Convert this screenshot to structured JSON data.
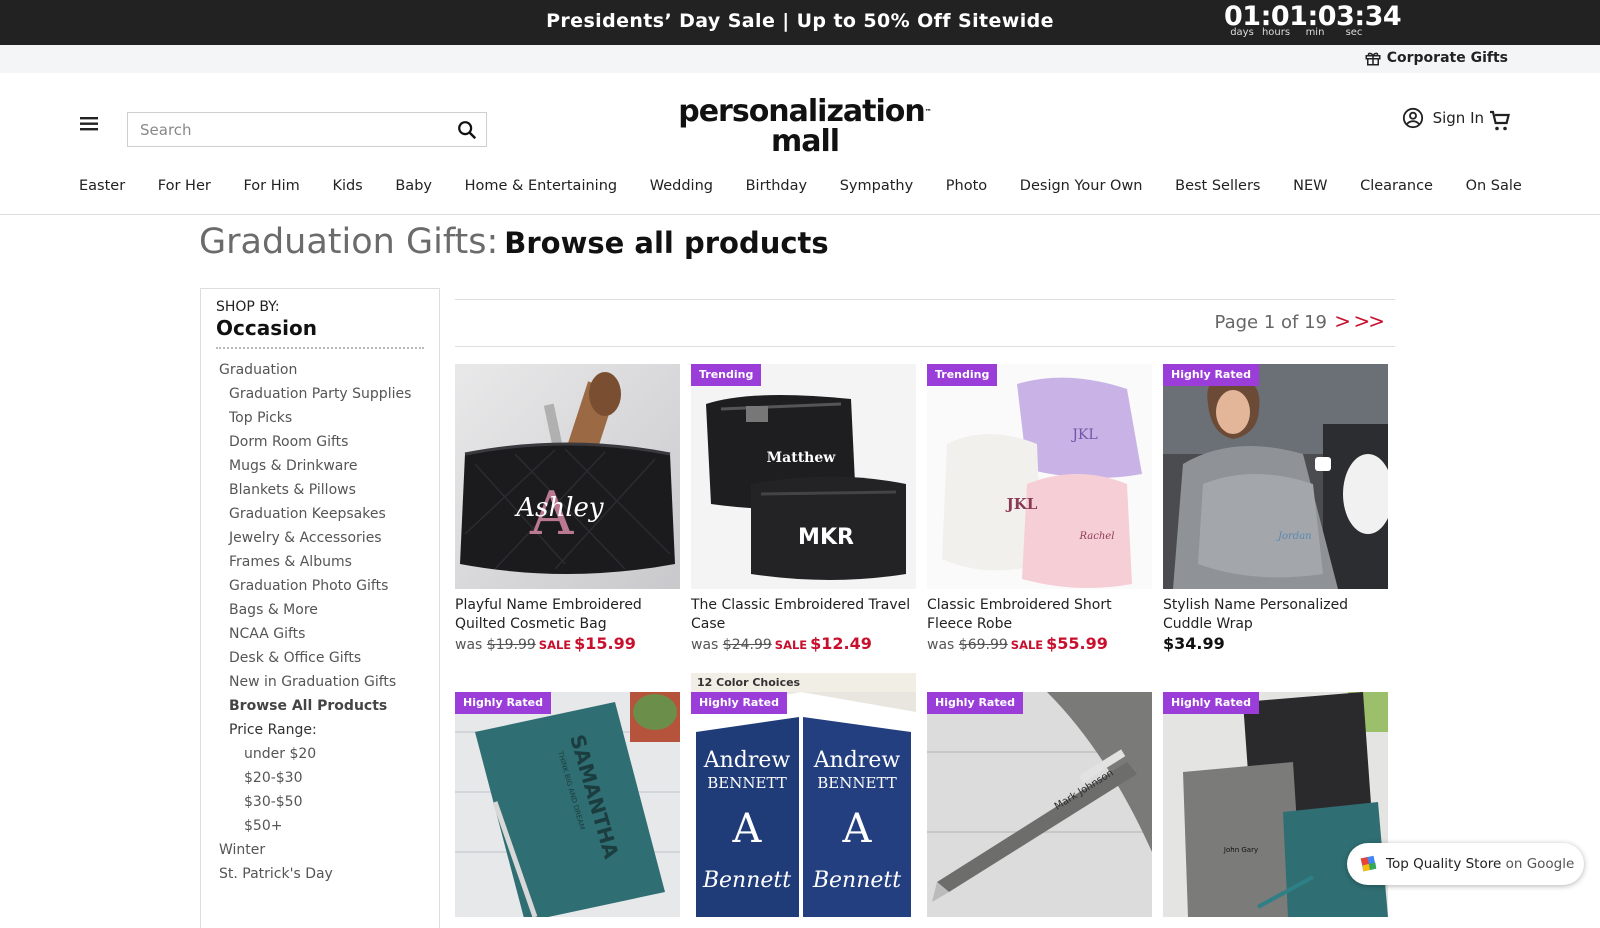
{
  "promo": {
    "message": "Presidents’ Day Sale | Up to 50% Off Sitewide",
    "countdown": "01:01:03:34",
    "units": [
      "days",
      "hours",
      "min",
      "sec"
    ]
  },
  "utility": {
    "corporate_label": "Corporate Gifts"
  },
  "header": {
    "search_placeholder": "Search",
    "logo_line1": "personalization",
    "logo_line2": "mall",
    "logo_tm": "™",
    "signin_label": "Sign In"
  },
  "nav": [
    "Easter",
    "For Her",
    "For Him",
    "Kids",
    "Baby",
    "Home & Entertaining",
    "Wedding",
    "Birthday",
    "Sympathy",
    "Photo",
    "Design Your Own",
    "Best Sellers",
    "NEW",
    "Clearance",
    "On Sale"
  ],
  "page": {
    "category": "Graduation Gifts:",
    "subtitle": "Browse all products"
  },
  "sidebar": {
    "shop_by": "SHOP BY:",
    "heading": "Occasion",
    "items": [
      {
        "label": "Graduation",
        "level": 0
      },
      {
        "label": "Graduation Party Supplies",
        "level": 1
      },
      {
        "label": "Top Picks",
        "level": 1
      },
      {
        "label": "Dorm Room Gifts",
        "level": 1
      },
      {
        "label": "Mugs & Drinkware",
        "level": 1
      },
      {
        "label": "Blankets & Pillows",
        "level": 1
      },
      {
        "label": "Graduation Keepsakes",
        "level": 1
      },
      {
        "label": "Jewelry & Accessories",
        "level": 1
      },
      {
        "label": "Frames & Albums",
        "level": 1
      },
      {
        "label": "Graduation Photo Gifts",
        "level": 1
      },
      {
        "label": "Bags & More",
        "level": 1
      },
      {
        "label": "NCAA Gifts",
        "level": 1
      },
      {
        "label": "Desk & Office Gifts",
        "level": 1
      },
      {
        "label": "New in Graduation Gifts",
        "level": 1
      },
      {
        "label": "Browse All Products",
        "level": 1,
        "current": true
      },
      {
        "label": "Price Range:",
        "level": 1,
        "label_only": true
      },
      {
        "label": "under $20",
        "level": 2
      },
      {
        "label": "$20-$30",
        "level": 2
      },
      {
        "label": "$30-$50",
        "level": 2
      },
      {
        "label": "$50+",
        "level": 2
      },
      {
        "label": "Winter",
        "level": 0
      },
      {
        "label": "St. Patrick's Day",
        "level": 0
      }
    ]
  },
  "pager": {
    "text": "Page 1 of 19",
    "next": ">",
    "last": ">>"
  },
  "products": [
    {
      "badge": "",
      "name": "Playful Name Embroidered Quilted Cosmetic Bag",
      "was_label": "was",
      "was": "$19.99",
      "sale_label": "SALE",
      "price": "$15.99",
      "img_text": "Ashley",
      "img_icon": "cosmetic-bag-image"
    },
    {
      "badge": "Trending",
      "name": "The Classic Embroidered Travel Case",
      "was_label": "was",
      "was": "$24.99",
      "sale_label": "SALE",
      "price": "$12.49",
      "img_text": "Matthew",
      "img_text2": "MKR",
      "img_icon": "travel-case-image"
    },
    {
      "badge": "Trending",
      "name": "Classic Embroidered Short Fleece Robe",
      "was_label": "was",
      "was": "$69.99",
      "sale_label": "SALE",
      "price": "$55.99",
      "img_text": "JKL",
      "img_text2": "Rachel",
      "img_icon": "fleece-robe-image"
    },
    {
      "badge": "Highly Rated",
      "name": "Stylish Name Personalized Cuddle Wrap",
      "was_label": "",
      "was": "",
      "sale_label": "",
      "price": "$34.99",
      "img_text": "Jordan",
      "img_icon": "cuddle-wrap-image"
    },
    {
      "badge": "Highly Rated",
      "img_text": "SAMANTHA",
      "img_text2": "THINK BIG AND DREAM",
      "img_icon": "journal-image"
    },
    {
      "badge": "Highly Rated",
      "top_label": "12 Color Choices",
      "img_text": "Andrew",
      "img_text2": "BENNETT",
      "img_text3": "A",
      "img_icon": "note-cube-image"
    },
    {
      "badge": "Highly Rated",
      "img_text": "Mark Johnson",
      "img_icon": "pen-image"
    },
    {
      "badge": "Highly Rated",
      "img_text": "John Gary",
      "img_icon": "padfolio-image"
    }
  ],
  "google_badge": {
    "label": "Top Quality Store",
    "suffix": "on Google"
  },
  "colors": {
    "accent": "#c8102e",
    "badge": "#9b3dd9",
    "promo_bg": "#222222"
  }
}
